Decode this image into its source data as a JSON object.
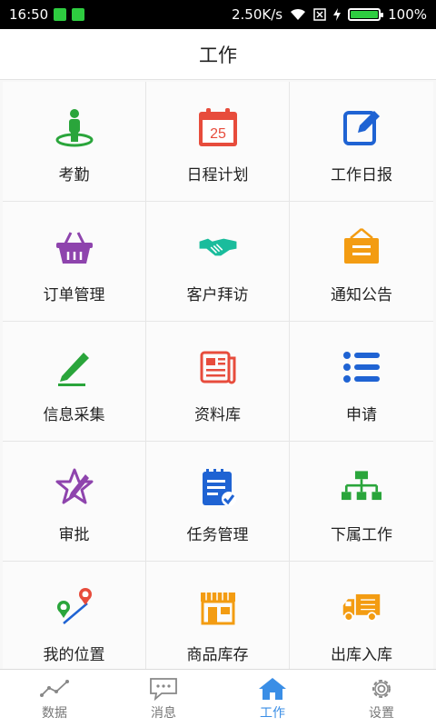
{
  "status_bar": {
    "time": "16:50",
    "network_speed": "2.50K/s",
    "battery": "100%"
  },
  "header": {
    "title": "工作"
  },
  "grid": {
    "items": [
      {
        "label": "考勤",
        "icon": "attendance-person-icon",
        "color": "#2aa53b"
      },
      {
        "label": "日程计划",
        "icon": "calendar-icon",
        "color": "#e74c3c",
        "icon_text": "25"
      },
      {
        "label": "工作日报",
        "icon": "edit-square-icon",
        "color": "#1f63d3"
      },
      {
        "label": "订单管理",
        "icon": "basket-icon",
        "color": "#8e44ad"
      },
      {
        "label": "客户拜访",
        "icon": "handshake-icon",
        "color": "#1abc9c"
      },
      {
        "label": "通知公告",
        "icon": "notice-board-icon",
        "color": "#f39c12"
      },
      {
        "label": "信息采集",
        "icon": "pencil-icon",
        "color": "#2aa53b"
      },
      {
        "label": "资料库",
        "icon": "newspaper-icon",
        "color": "#e74c3c"
      },
      {
        "label": "申请",
        "icon": "list-icon",
        "color": "#1f63d3"
      },
      {
        "label": "审批",
        "icon": "star-pen-icon",
        "color": "#8e44ad"
      },
      {
        "label": "任务管理",
        "icon": "clipboard-check-icon",
        "color": "#1f63d3"
      },
      {
        "label": "下属工作",
        "icon": "org-chart-icon",
        "color": "#2aa53b"
      },
      {
        "label": "我的位置",
        "icon": "route-pins-icon",
        "color": "#e74c3c"
      },
      {
        "label": "商品库存",
        "icon": "store-icon",
        "color": "#f39c12"
      },
      {
        "label": "出库入库",
        "icon": "truck-icon",
        "color": "#f39c12"
      }
    ]
  },
  "bottom_nav": {
    "items": [
      {
        "label": "数据",
        "icon": "chart-line-icon"
      },
      {
        "label": "消息",
        "icon": "chat-bubble-icon"
      },
      {
        "label": "工作",
        "icon": "home-icon",
        "active": true
      },
      {
        "label": "设置",
        "icon": "gear-icon"
      }
    ]
  }
}
